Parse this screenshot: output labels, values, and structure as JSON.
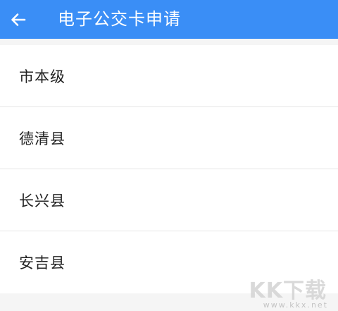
{
  "header": {
    "title": "电子公交卡申请",
    "back_icon": "arrow-left-icon",
    "background_color": "#3a8ef6"
  },
  "list": {
    "items": [
      {
        "label": "市本级"
      },
      {
        "label": "德清县"
      },
      {
        "label": "长兴县"
      },
      {
        "label": "安吉县"
      }
    ]
  },
  "watermark": {
    "text": "KK下载",
    "url": "www.kkx.net"
  }
}
